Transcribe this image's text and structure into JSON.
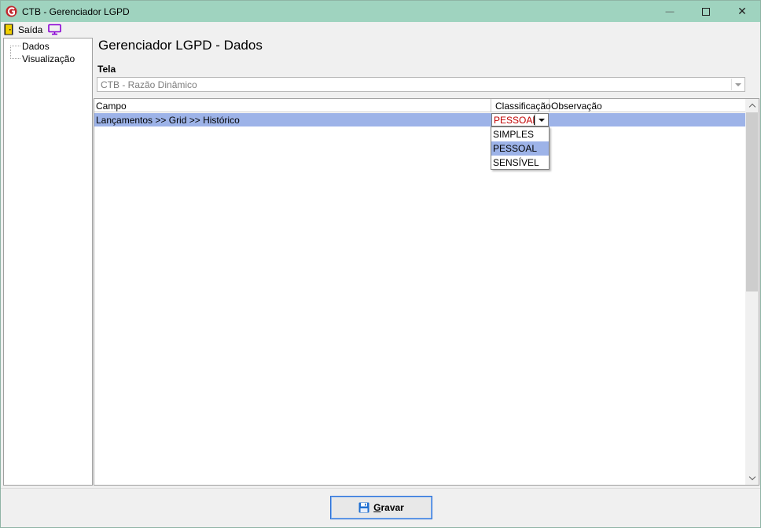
{
  "window": {
    "title": "CTB - Gerenciador LGPD",
    "minimize_glyph": "—",
    "maximize_glyph": "□",
    "close_glyph": "✕"
  },
  "menubar": {
    "exit_label": "Saída",
    "exit_icon": "door-icon",
    "monitor_icon": "monitor-icon"
  },
  "tree": {
    "items": [
      {
        "label": "Dados"
      },
      {
        "label": "Visualização"
      }
    ]
  },
  "main": {
    "title": "Gerenciador LGPD - Dados",
    "tela_label": "Tela",
    "tela_value": "CTB - Razão Dinâmico"
  },
  "grid": {
    "columns": [
      "Campo",
      "Classificação",
      "Observação"
    ],
    "rows": [
      {
        "campo": "Lançamentos >> Grid >> Histórico",
        "classificacao": "PESSOAL",
        "observacao": ""
      }
    ],
    "editor_value": "PESSOAL",
    "dropdown_options": [
      "SIMPLES",
      "PESSOAL",
      "SENSÍVEL"
    ],
    "dropdown_selected": "PESSOAL"
  },
  "footer": {
    "save_label": "Gravar"
  },
  "colors": {
    "titlebar": "#9fd3bf",
    "selection": "#9db3e8",
    "editor_text": "#c00000",
    "button_border": "#2b6fd6"
  }
}
